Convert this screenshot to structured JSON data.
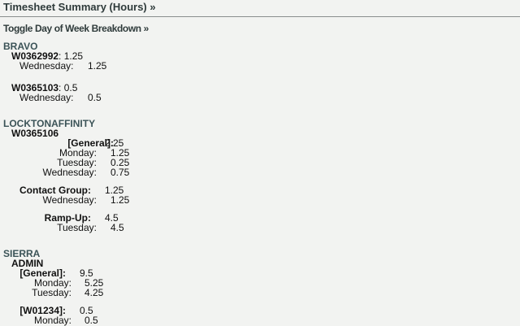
{
  "header": {
    "title": "Timesheet Summary (Hours) »",
    "toggle": "Toggle Day of Week Breakdown »"
  },
  "bravo": {
    "client": "BRAVO",
    "w1": {
      "code": "W0362992",
      "sep": ":",
      "total": "1.25",
      "day": "Wednesday:",
      "hours": "1.25"
    },
    "w2": {
      "code": "W0365103",
      "sep": ":",
      "total": "0.5",
      "day": "Wednesday:",
      "hours": "0.5"
    }
  },
  "lockton": {
    "client": "LOCKTONAFFINITY",
    "code": "W0365106",
    "general": {
      "label": "[General]:",
      "total": "2.25",
      "days": [
        {
          "day": "Monday:",
          "hours": "1.25"
        },
        {
          "day": "Tuesday:",
          "hours": "0.25"
        },
        {
          "day": "Wednesday:",
          "hours": "0.75"
        }
      ]
    },
    "contact": {
      "label": "Contact Group:",
      "total": "1.25",
      "day": "Wednesday:",
      "hours": "1.25"
    },
    "ramp": {
      "label": "Ramp-Up:",
      "total": "4.5",
      "day": "Tuesday:",
      "hours": "4.5"
    }
  },
  "sierra": {
    "client": "SIERRA",
    "code": "ADMIN",
    "general": {
      "label": "[General]:",
      "total": "9.5",
      "days": [
        {
          "day": "Monday:",
          "hours": "5.25"
        },
        {
          "day": "Tuesday:",
          "hours": "4.25"
        }
      ]
    },
    "w01234": {
      "label": "[W01234]:",
      "total": "0.5",
      "day": "Monday:",
      "hours": "0.5"
    }
  }
}
